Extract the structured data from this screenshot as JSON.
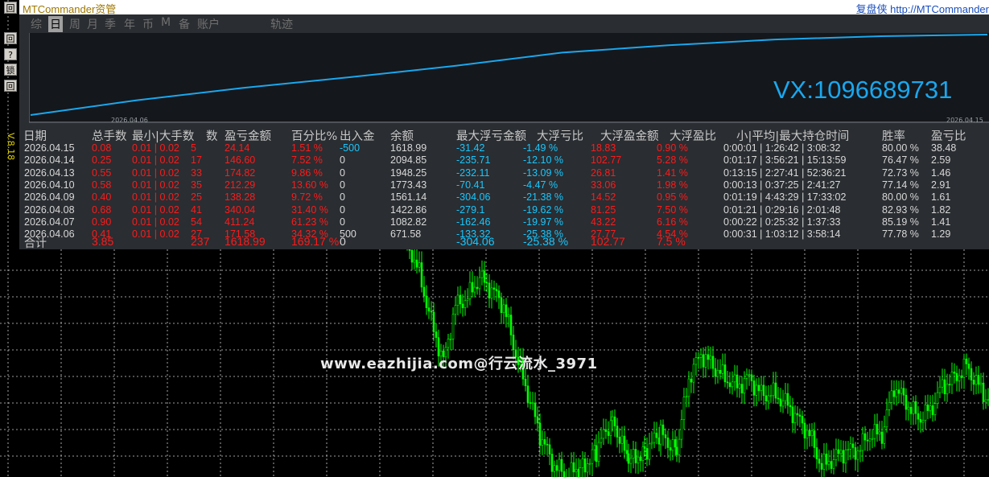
{
  "title_bar": {
    "app_title": "MTCommander资管",
    "right_text": "复盘侠 http://MTCommander"
  },
  "toolbar": {
    "buttons": [
      "回",
      "?",
      "锁",
      "回"
    ],
    "version": "V.8.18"
  },
  "tabs": [
    "综",
    "日",
    "周",
    "月",
    "季",
    "年",
    "币",
    "M",
    "备",
    "账户",
    "轨迹"
  ],
  "active_tab": "日",
  "equity_chart": {
    "dates": [
      "2026.04.06",
      "2026.04.15"
    ],
    "line_color": "#1aa7ee",
    "values": [
      0.02,
      0.2,
      0.35,
      0.48,
      0.62,
      0.78,
      0.87,
      0.94,
      0.98,
      1.0
    ]
  },
  "contact": "VX:1096689731",
  "table": {
    "headers": [
      "日期",
      "总手数",
      "最小|最大手数",
      "笔数",
      "盈亏金额",
      "百分比%",
      "出入金",
      "余额",
      "最大浮亏金额",
      "最大浮亏比",
      "最大浮盈金额",
      "最大浮盈比",
      "最小|平均|最大持仓时间",
      "胜率",
      "盈亏比"
    ],
    "header_display": [
      "日期",
      "总手数",
      "最小|大手数",
      "数",
      "盈亏金额",
      "百分比%",
      "出入金",
      "余额",
      "最大浮亏金额",
      "大浮亏比",
      "大浮盈金额",
      "大浮盈比",
      "小|平均|最大持仓时间",
      "胜率",
      "盈亏比"
    ],
    "rows": [
      {
        "date": "2026.04.15",
        "lots": "0.08",
        "minmax": "0.01 | 0.02",
        "trades": "5",
        "pnl": "24.14",
        "pct": "1.51 %",
        "io": "-500",
        "balance": "1618.99",
        "max_float_loss": "-31.42",
        "max_float_loss_pct": "-1.49 %",
        "max_float_profit": "18.83",
        "max_float_profit_pct": "0.90 %",
        "hold": "0:00:01 | 1:26:42 | 3:08:32",
        "winrate": "80.00 %",
        "pf": "38.48"
      },
      {
        "date": "2026.04.14",
        "lots": "0.25",
        "minmax": "0.01 | 0.02",
        "trades": "17",
        "pnl": "146.60",
        "pct": "7.52 %",
        "io": "0",
        "balance": "2094.85",
        "max_float_loss": "-235.71",
        "max_float_loss_pct": "-12.10 %",
        "max_float_profit": "102.77",
        "max_float_profit_pct": "5.28 %",
        "hold": "0:01:17 | 3:56:21 | 15:13:59",
        "winrate": "76.47 %",
        "pf": "2.59"
      },
      {
        "date": "2026.04.13",
        "lots": "0.55",
        "minmax": "0.01 | 0.02",
        "trades": "33",
        "pnl": "174.82",
        "pct": "9.86 %",
        "io": "0",
        "balance": "1948.25",
        "max_float_loss": "-232.11",
        "max_float_loss_pct": "-13.09 %",
        "max_float_profit": "26.81",
        "max_float_profit_pct": "1.41 %",
        "hold": "0:13:15 | 2:27:41 | 52:36:21",
        "winrate": "72.73 %",
        "pf": "1.46"
      },
      {
        "date": "2026.04.10",
        "lots": "0.58",
        "minmax": "0.01 | 0.02",
        "trades": "35",
        "pnl": "212.29",
        "pct": "13.60 %",
        "io": "0",
        "balance": "1773.43",
        "max_float_loss": "-70.41",
        "max_float_loss_pct": "-4.47 %",
        "max_float_profit": "33.06",
        "max_float_profit_pct": "1.98 %",
        "hold": "0:00:13 | 0:37:25 | 2:41:27",
        "winrate": "77.14 %",
        "pf": "2.91"
      },
      {
        "date": "2026.04.09",
        "lots": "0.40",
        "minmax": "0.01 | 0.02",
        "trades": "25",
        "pnl": "138.28",
        "pct": "9.72 %",
        "io": "0",
        "balance": "1561.14",
        "max_float_loss": "-304.06",
        "max_float_loss_pct": "-21.38 %",
        "max_float_profit": "14.52",
        "max_float_profit_pct": "0.95 %",
        "hold": "0:01:19 | 4:43:29 | 17:33:02",
        "winrate": "80.00 %",
        "pf": "1.61"
      },
      {
        "date": "2026.04.08",
        "lots": "0.68",
        "minmax": "0.01 | 0.02",
        "trades": "41",
        "pnl": "340.04",
        "pct": "31.40 %",
        "io": "0",
        "balance": "1422.86",
        "max_float_loss": "-279.1",
        "max_float_loss_pct": "-19.62 %",
        "max_float_profit": "81.25",
        "max_float_profit_pct": "7.50 %",
        "hold": "0:01:21 | 0:29:16 | 2:01:48",
        "winrate": "82.93 %",
        "pf": "1.82"
      },
      {
        "date": "2026.04.07",
        "lots": "0.90",
        "minmax": "0.01 | 0.02",
        "trades": "54",
        "pnl": "411.24",
        "pct": "61.23 %",
        "io": "0",
        "balance": "1082.82",
        "max_float_loss": "-162.46",
        "max_float_loss_pct": "-19.97 %",
        "max_float_profit": "43.22",
        "max_float_profit_pct": "6.16 %",
        "hold": "0:00:22 | 0:25:32 | 1:37:33",
        "winrate": "85.19 %",
        "pf": "1.41"
      },
      {
        "date": "2026.04.06",
        "lots": "0.41",
        "minmax": "0.01 | 0.02",
        "trades": "27",
        "pnl": "171.58",
        "pct": "34.32 %",
        "io": "500",
        "balance": "671.58",
        "max_float_loss": "-133.32",
        "max_float_loss_pct": "-25.38 %",
        "max_float_profit": "27.77",
        "max_float_profit_pct": "4.54 %",
        "hold": "0:00:31 | 1:03:12 | 3:58:14",
        "winrate": "77.78 %",
        "pf": "1.29"
      }
    ],
    "total": {
      "label": "合计",
      "lots": "3.85",
      "trades": "237",
      "pnl": "1618.99",
      "pct": "169.17 %",
      "io": "0",
      "max_float_loss": "-304.06",
      "max_float_loss_pct": "-25.38 %",
      "max_float_profit": "102.77",
      "max_float_profit_pct": "7.5 %"
    }
  },
  "watermark": "www.eazhijia.com@行云流水_3971",
  "colors": {
    "panel_bg": "#2a2d31",
    "profit": "#ff1a1a",
    "loss": "#17c8ff",
    "candles": "#00ff00",
    "grid": "#ffffff"
  }
}
